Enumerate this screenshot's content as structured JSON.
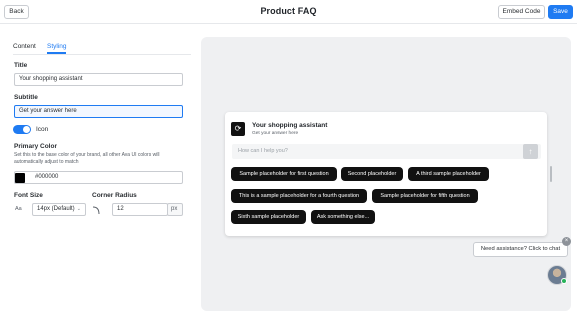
{
  "header": {
    "back_label": "Back",
    "title": "Product FAQ",
    "embed_label": "Embed Code",
    "save_label": "Save"
  },
  "tabs": [
    {
      "label": "Content"
    },
    {
      "label": "Styling"
    }
  ],
  "form": {
    "title_label": "Title",
    "title_value": "Your shopping assistant",
    "subtitle_label": "Subtitle",
    "subtitle_value": "Get your answer here",
    "icon_toggle_label": "Icon",
    "primary_color_label": "Primary Color",
    "primary_color_help": "Set this to the base color of your brand, all other Ava UI colors will automatically adjust to match",
    "primary_color_value": "#000000",
    "font_size_label": "Font Size",
    "font_size_value": "14px (Default)",
    "font_glyph": "Aa",
    "corner_radius_label": "Corner Radius",
    "corner_radius_value": "12",
    "corner_radius_unit": "px"
  },
  "widget": {
    "title": "Your shopping assistant",
    "subtitle": "Get your answer here",
    "input_placeholder": "How can I help you?",
    "chips": [
      "Sample placeholder for first question",
      "Second placeholder",
      "A third sample placeholder",
      "This is a sample placeholder for a fourth question",
      "Sample placeholder for fifth question",
      "Sixth sample placeholder",
      "Ask something else..."
    ]
  },
  "launcher": {
    "bubble_text": "Need assistance? Click to chat",
    "close_glyph": "×"
  },
  "colors": {
    "accent": "#1f7bf2",
    "chip_bg": "#111111",
    "preview_bg": "#eff0f2"
  }
}
